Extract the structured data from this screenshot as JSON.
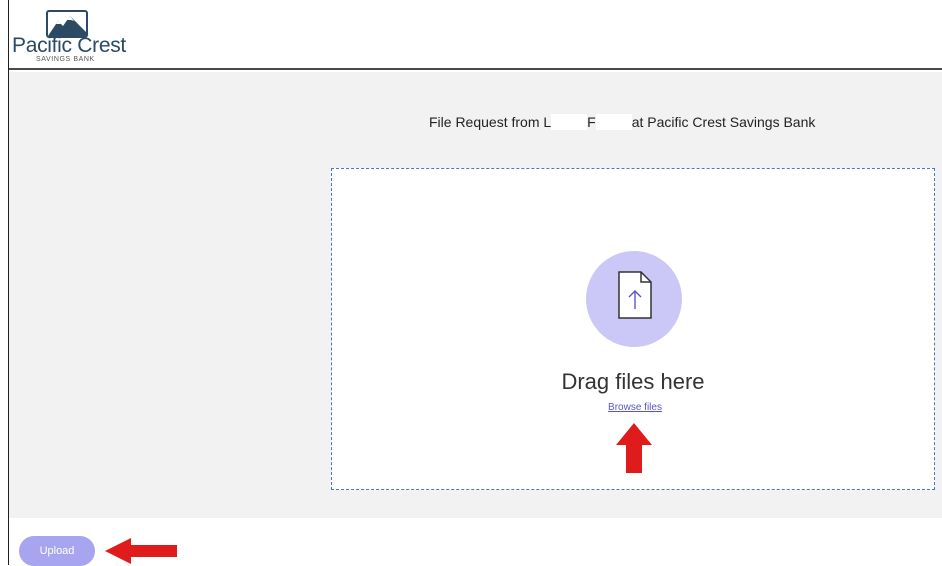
{
  "brand": {
    "name": "Pacific Crest",
    "subtitle": "SAVINGS BANK",
    "logo_icon": "mountain-logo-icon",
    "color": "#2c4a64"
  },
  "request": {
    "prefix": "File Request from L",
    "middle": "F",
    "suffix": "at Pacific Crest Savings Bank"
  },
  "dropzone": {
    "icon": "file-upload-icon",
    "drag_text": "Drag files here",
    "browse_label": "Browse files"
  },
  "footer": {
    "upload_label": "Upload"
  },
  "colors": {
    "accent": "#a7a4f0",
    "icon_circle": "#cbc8f8",
    "link": "#5a56c8",
    "annotation_arrow": "#e01b1b",
    "dropzone_border": "#4a7bb7"
  }
}
